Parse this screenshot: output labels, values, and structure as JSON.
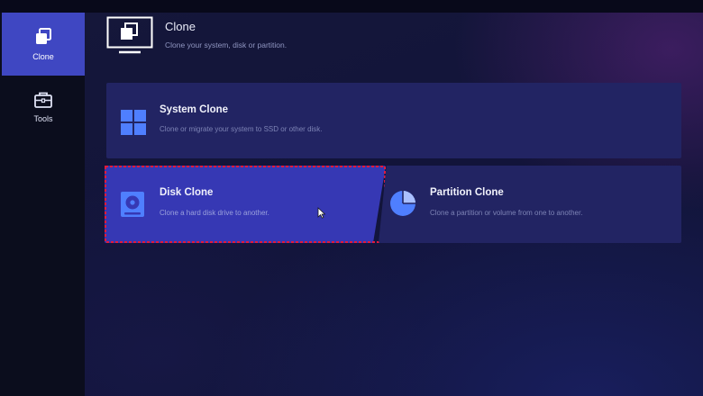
{
  "sidebar": {
    "items": [
      {
        "label": "Clone",
        "icon": "clone-icon",
        "active": true
      },
      {
        "label": "Tools",
        "icon": "toolbox-icon",
        "active": false
      }
    ]
  },
  "header": {
    "title": "Clone",
    "subtitle": "Clone your system, disk or partition."
  },
  "cards": {
    "system": {
      "title": "System Clone",
      "description": "Clone or migrate your system to SSD or other disk.",
      "icon": "windows-icon"
    },
    "disk": {
      "title": "Disk Clone",
      "description": "Clone a hard disk drive to another.",
      "icon": "hard-disk-icon",
      "selected": true
    },
    "partition": {
      "title": "Partition Clone",
      "description": "Clone a partition or volume from one to another.",
      "icon": "pie-chart-icon"
    }
  },
  "colors": {
    "accent": "#3f47c2",
    "card_background": "#222463",
    "selected_card": "#3638b4",
    "selection_outline": "#e11a3c",
    "icon_blue": "#4f7fff"
  }
}
